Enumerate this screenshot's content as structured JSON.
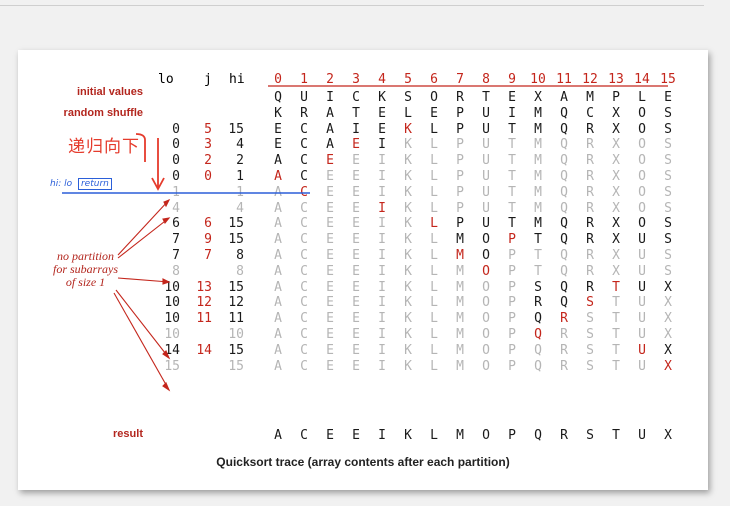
{
  "headers": {
    "lo": "lo",
    "j": "j",
    "hi": "hi",
    "indices": [
      "0",
      "1",
      "2",
      "3",
      "4",
      "5",
      "6",
      "7",
      "8",
      "9",
      "10",
      "11",
      "12",
      "13",
      "14",
      "15"
    ]
  },
  "labels": {
    "initial": "initial values",
    "shuffle": "random shuffle",
    "result": "result"
  },
  "note": [
    "no partition",
    "for subarrays",
    "of size 1"
  ],
  "caption": "Quicksort trace (array contents after each partition)",
  "handwriting": {
    "chinese": "递归向下",
    "blue_label": "hi: lo",
    "blue_boxed": "return"
  },
  "colors": {
    "red": "#c4261c",
    "black": "#1a1a1a",
    "gray": "#b5b5b5",
    "blue": "#2b5fd9",
    "handred": "#e53b2c"
  },
  "rows": [
    {
      "kind": "label",
      "label_key": "initial",
      "letters": "QUICKSORTEXAMPLE",
      "style": "kkkkkkkkkkkkkkkk"
    },
    {
      "kind": "label",
      "label_key": "shuffle",
      "letters": "KRATELEPUIMQCXOS",
      "style": "kkkkkkkkkkkkkkkk"
    },
    {
      "lo": "0",
      "j": "5",
      "hi": "15",
      "numstyle": "k",
      "letters": "ECAIEKLPUTMQRXOS",
      "style": "kkkkkrkkkkkkkkkk"
    },
    {
      "lo": "0",
      "j": "3",
      "hi": "4",
      "numstyle": "k",
      "letters": "ECAEIKLPUTMQRXOS",
      "style": "kkkrkggggggggggg"
    },
    {
      "lo": "0",
      "j": "2",
      "hi": "2",
      "numstyle": "k",
      "letters": "ACEEIKLPUTMQRXOS",
      "style": "kkrggggggggggggg"
    },
    {
      "lo": "0",
      "j": "0",
      "hi": "1",
      "numstyle": "k",
      "letters": "ACEEIKLPUTMQRXOS",
      "style": "rkgggggggggggggg"
    },
    {
      "lo": "1",
      "j": "",
      "hi": "1",
      "numstyle": "g",
      "letters": "ACEEIKLPUTMQRXOS",
      "style": "grgggggggggggggg"
    },
    {
      "lo": "4",
      "j": "",
      "hi": "4",
      "numstyle": "g",
      "letters": "ACEEIKLPUTMQRXOS",
      "style": "ggggrggggggggggg"
    },
    {
      "lo": "6",
      "j": "6",
      "hi": "15",
      "numstyle": "k",
      "letters": "ACEEIKLPUTMQRXOS",
      "style": "ggggggrkkkkkkkkk"
    },
    {
      "lo": "7",
      "j": "9",
      "hi": "15",
      "numstyle": "k",
      "letters": "ACEEIKLMOPTQRXUS",
      "style": "gggggggkkrkkkkkk"
    },
    {
      "lo": "7",
      "j": "7",
      "hi": "8",
      "numstyle": "k",
      "letters": "ACEEIKLMOPTQRXUS",
      "style": "gggggggrkggggggg"
    },
    {
      "lo": "8",
      "j": "",
      "hi": "8",
      "numstyle": "g",
      "letters": "ACEEIKLMOPTQRXUS",
      "style": "ggggggggrggggggg"
    },
    {
      "lo": "10",
      "j": "13",
      "hi": "15",
      "numstyle": "k",
      "letters": "ACEEIKLMOPSQRTUX",
      "style": "ggggggggggkkkrkk"
    },
    {
      "lo": "10",
      "j": "12",
      "hi": "12",
      "numstyle": "k",
      "letters": "ACEEIKLMOPRQSTUX",
      "style": "ggggggggggkkrggg"
    },
    {
      "lo": "10",
      "j": "11",
      "hi": "11",
      "numstyle": "k",
      "letters": "ACEEIKLMOPQRSTUX",
      "style": "ggggggggggkrgggg"
    },
    {
      "lo": "10",
      "j": "",
      "hi": "10",
      "numstyle": "g",
      "letters": "ACEEIKLMOPQRSTUX",
      "style": "ggggggggggrggggg"
    },
    {
      "lo": "14",
      "j": "14",
      "hi": "15",
      "numstyle": "k",
      "letters": "ACEEIKLMOPQRSTUX",
      "style": "ggggggggggggggrk"
    },
    {
      "lo": "15",
      "j": "",
      "hi": "15",
      "numstyle": "g",
      "letters": "ACEEIKLMOPQRSTUX",
      "style": "gggggggggggggggr"
    },
    {
      "kind": "label",
      "label_key": "result",
      "letters": "ACEEIKLMOPQRSTUX",
      "style": "kkkkkkkkkkkkkkkk"
    }
  ]
}
